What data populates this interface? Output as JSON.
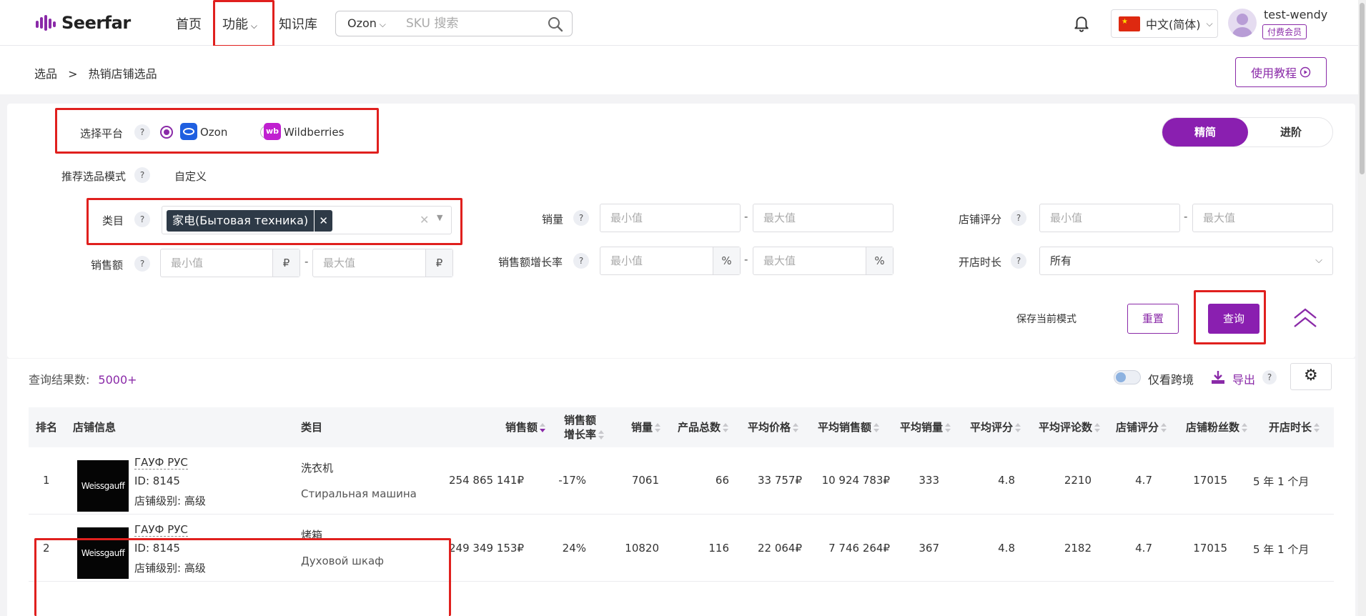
{
  "header": {
    "logo_text": "Seerfar",
    "nav": [
      {
        "label": "首页"
      },
      {
        "label": "功能"
      },
      {
        "label": "知识库"
      }
    ],
    "search": {
      "platform": "Ozon",
      "placeholder": "SKU 搜索"
    },
    "language": "中文(简体)",
    "username": "test-wendy",
    "membership": "付费会员"
  },
  "breadcrumb": {
    "root": "选品",
    "sep": ">",
    "current": "热销店铺选品"
  },
  "tutorial_label": "使用教程",
  "filters": {
    "platform_label": "选择平台",
    "platforms": [
      {
        "label": "Ozon",
        "selected": true
      },
      {
        "label": "Wildberries",
        "selected": false
      }
    ],
    "mode_label": "推荐选品模式",
    "mode_value": "自定义",
    "view_tabs": [
      "精简",
      "进阶"
    ],
    "category_label": "类目",
    "category_tag": "家电(Бытовая техника)",
    "sales_qty_label": "销量",
    "store_rating_label": "店铺评分",
    "sales_amount_label": "销售额",
    "growth_label": "销售额增长率",
    "store_age_label": "开店时长",
    "store_age_value": "所有",
    "min_placeholder": "最小值",
    "max_placeholder": "最大值",
    "currency": "₽",
    "percent": "%",
    "dash": "-",
    "save_label": "保存当前模式",
    "reset_label": "重置",
    "query_label": "查询"
  },
  "results": {
    "count_label": "查询结果数:",
    "count_value": "5000+",
    "cross_border_label": "仅看跨境",
    "export_label": "导出",
    "columns": {
      "rank": "排名",
      "store": "店铺信息",
      "category": "类目",
      "sales_amount": "销售额",
      "growth_1": "销售额",
      "growth_2": "增长率",
      "sales_qty": "销量",
      "products": "产品总数",
      "avg_price": "平均价格",
      "avg_sales_amount": "平均销售额",
      "avg_sales_qty": "平均销量",
      "avg_rating": "平均评分",
      "avg_reviews": "平均评论数",
      "store_rating": "店铺评分",
      "followers": "店铺粉丝数",
      "store_age": "开店时长"
    },
    "rows": [
      {
        "rank": "1",
        "logo": "Weissgauff",
        "store_name": "ГАУФ РУС",
        "store_id": "ID: 8145",
        "store_level": "店铺级别: 高级",
        "category_cn": "洗衣机",
        "category_ru": "Стиральная машина",
        "sales_amount": "254 865 141₽",
        "growth": "-17%",
        "sales_qty": "7061",
        "products": "66",
        "avg_price": "33 757₽",
        "avg_sales_amount": "10 924 783₽",
        "avg_sales_qty": "333",
        "avg_rating": "4.8",
        "avg_reviews": "2210",
        "store_rating": "4.7",
        "followers": "17015",
        "store_age": "5 年 1 个月"
      },
      {
        "rank": "2",
        "logo": "Weissgauff",
        "store_name": "ГАУФ РУС",
        "store_id": "ID: 8145",
        "store_level": "店铺级别: 高级",
        "category_cn": "烤箱",
        "category_ru": "Духовой шкаф",
        "sales_amount": "249 349 153₽",
        "growth": "24%",
        "sales_qty": "10820",
        "products": "116",
        "avg_price": "22 064₽",
        "avg_sales_amount": "7 746 264₽",
        "avg_sales_qty": "367",
        "avg_rating": "4.8",
        "avg_reviews": "2182",
        "store_rating": "4.7",
        "followers": "17015",
        "store_age": "5 年 1 个月"
      }
    ]
  },
  "colors": {
    "accent": "#8a1fb0",
    "highlight": "#e0201e"
  }
}
